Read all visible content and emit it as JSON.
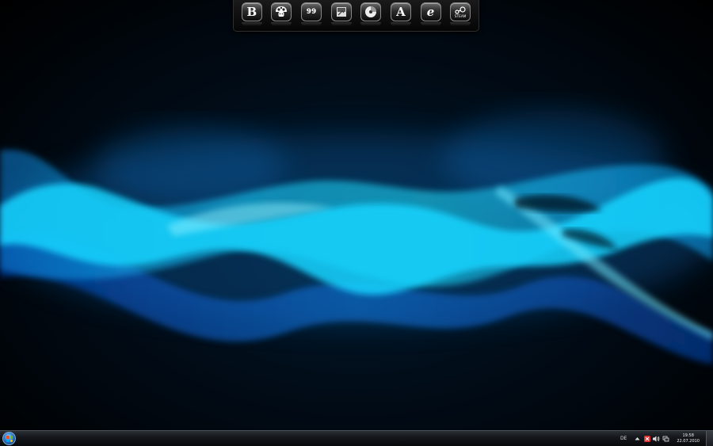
{
  "dock": {
    "items": [
      {
        "name": "bookmark-app",
        "glyph": "B"
      },
      {
        "name": "mushroom-app",
        "glyph": ""
      },
      {
        "name": "counter-app",
        "glyph": "99"
      },
      {
        "name": "document-app",
        "glyph": ""
      },
      {
        "name": "disc-app",
        "glyph": ""
      },
      {
        "name": "font-app",
        "glyph": "A"
      },
      {
        "name": "internet-explorer",
        "glyph": "e"
      },
      {
        "name": "steam",
        "glyph": "STEAM"
      }
    ]
  },
  "taskbar": {
    "language": "DE",
    "time": "19:58",
    "date": "22.07.2010"
  },
  "colors": {
    "wave_bright": "#19d4ff",
    "wave_mid": "#0a8ee8",
    "wave_deep": "#0540a8",
    "tray_alert": "#e03030"
  }
}
